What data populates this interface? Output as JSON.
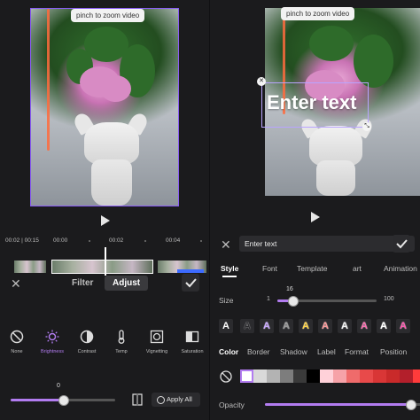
{
  "left": {
    "hint": "pinch to zoom video",
    "timeline": {
      "time_current": "00:02",
      "time_total": "00:15",
      "ticks": [
        "00:00",
        "00:02",
        "00:04"
      ]
    },
    "tabs": {
      "filter": "Filter",
      "adjust": "Adjust"
    },
    "tools": [
      {
        "label": "None",
        "icon": "none-icon"
      },
      {
        "label": "Brightness",
        "icon": "brightness-icon",
        "active": true
      },
      {
        "label": "Contrast",
        "icon": "contrast-icon"
      },
      {
        "label": "Temp",
        "icon": "temperature-icon"
      },
      {
        "label": "Vignetting",
        "icon": "vignetting-icon"
      },
      {
        "label": "Saturation",
        "icon": "saturation-icon"
      }
    ],
    "slider": {
      "value": "0",
      "fraction": 0.5
    },
    "apply_all": "Apply All"
  },
  "right": {
    "hint": "pinch to zoom video",
    "overlay_text": "Enter text",
    "input_value": "Enter text",
    "tabs": [
      "Style",
      "Font",
      "Template",
      "art",
      "Animation"
    ],
    "size": {
      "label": "Size",
      "min": "1",
      "max": "100",
      "value": "16",
      "fraction": 0.15
    },
    "subtabs": [
      "Color",
      "Border",
      "Shadow",
      "Label",
      "Format",
      "Position"
    ],
    "presets": [
      {
        "text": "A",
        "color": "#ffffff"
      },
      {
        "text": "A",
        "color": "#2b2b2e"
      },
      {
        "text": "A",
        "color": "#c9a8ff"
      },
      {
        "text": "A",
        "color": "#9a9a9a"
      },
      {
        "text": "A",
        "color": "#ffd447"
      },
      {
        "text": "A",
        "color": "#ff9a9a"
      },
      {
        "text": "A",
        "color": "#f2f2f2"
      },
      {
        "text": "A",
        "color": "#ff6fb1"
      },
      {
        "text": "A",
        "color": "#ffffff"
      },
      {
        "text": "A",
        "color": "#ff5ab0"
      }
    ],
    "colors": [
      "#ffffff",
      "#d9d9d9",
      "#b3b3b3",
      "#7d7d7d",
      "#3a3a3a",
      "#000000",
      "#ffd1d9",
      "#f6a2a8",
      "#ef6b6b",
      "#e84a4a",
      "#d93636",
      "#c92a2a",
      "#b31f2b",
      "#ff3b3b"
    ],
    "opacity": {
      "label": "Opacity",
      "fraction": 0.93
    }
  },
  "colors": {
    "accent": "#b27cf0",
    "selection": "#8a5cf6",
    "background": "#1b1b1d"
  }
}
